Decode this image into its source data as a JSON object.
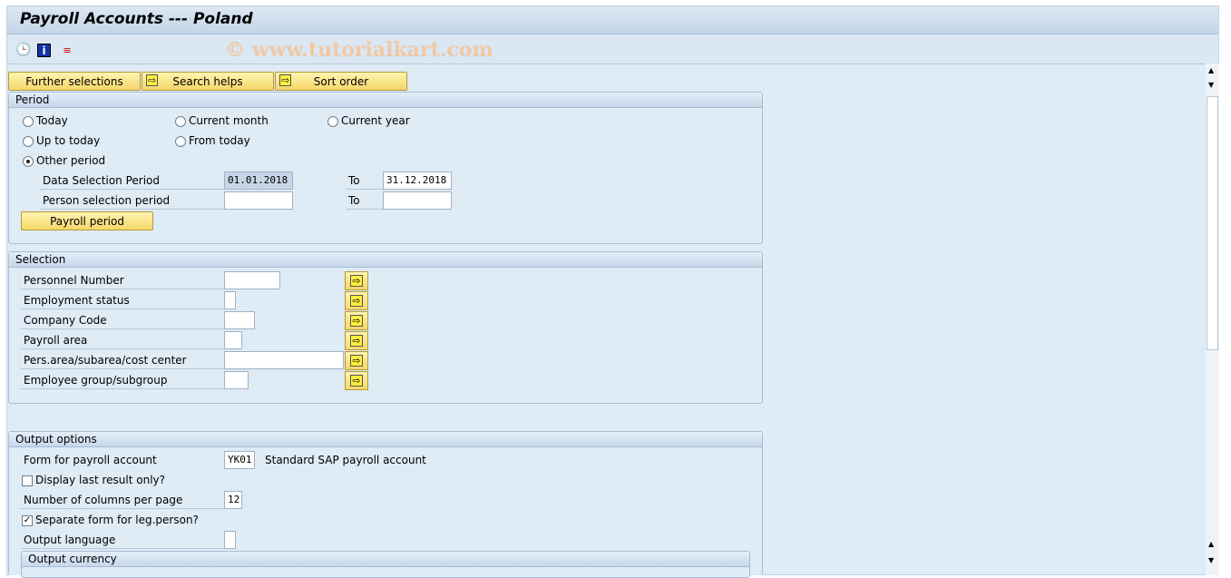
{
  "window": {
    "title": "Payroll Accounts --- Poland",
    "watermark": "© www.tutorialkart.com"
  },
  "toolbar": {
    "icons": [
      "execute-clock-icon",
      "info-icon",
      "variants-icon"
    ]
  },
  "buttons": {
    "further_selections": "Further selections",
    "search_helps": "Search helps",
    "sort_order": "Sort order"
  },
  "period": {
    "title": "Period",
    "radios": [
      {
        "label": "Today",
        "selected": false
      },
      {
        "label": "Current month",
        "selected": false
      },
      {
        "label": "Current year",
        "selected": false
      },
      {
        "label": "Up to today",
        "selected": false
      },
      {
        "label": "From today",
        "selected": false
      },
      {
        "label": "Other period",
        "selected": true
      }
    ],
    "data_sel_label": "Data Selection Period",
    "data_from": "01.01.2018",
    "to_label": "To",
    "data_to": "31.12.2018",
    "person_sel_label": "Person selection period",
    "person_from": "",
    "person_to": "",
    "payroll_period_button": "Payroll period"
  },
  "selection": {
    "title": "Selection",
    "fields": [
      {
        "label": "Personnel Number",
        "value": ""
      },
      {
        "label": "Employment status",
        "value": ""
      },
      {
        "label": "Company Code",
        "value": ""
      },
      {
        "label": "Payroll area",
        "value": ""
      },
      {
        "label": "Pers.area/subarea/cost center",
        "value": ""
      },
      {
        "label": "Employee group/subgroup",
        "value": ""
      }
    ]
  },
  "output": {
    "title": "Output options",
    "form_label": "Form for payroll account",
    "form_value": "YK01",
    "form_desc": "Standard SAP payroll account",
    "display_last_label": "Display last result only?",
    "display_last_checked": false,
    "columns_label": "Number of columns per page",
    "columns_value": "12",
    "separate_label": "Separate form for leg.person?",
    "separate_checked": true,
    "language_label": "Output language",
    "language_value": "",
    "currency_title": "Output currency"
  }
}
